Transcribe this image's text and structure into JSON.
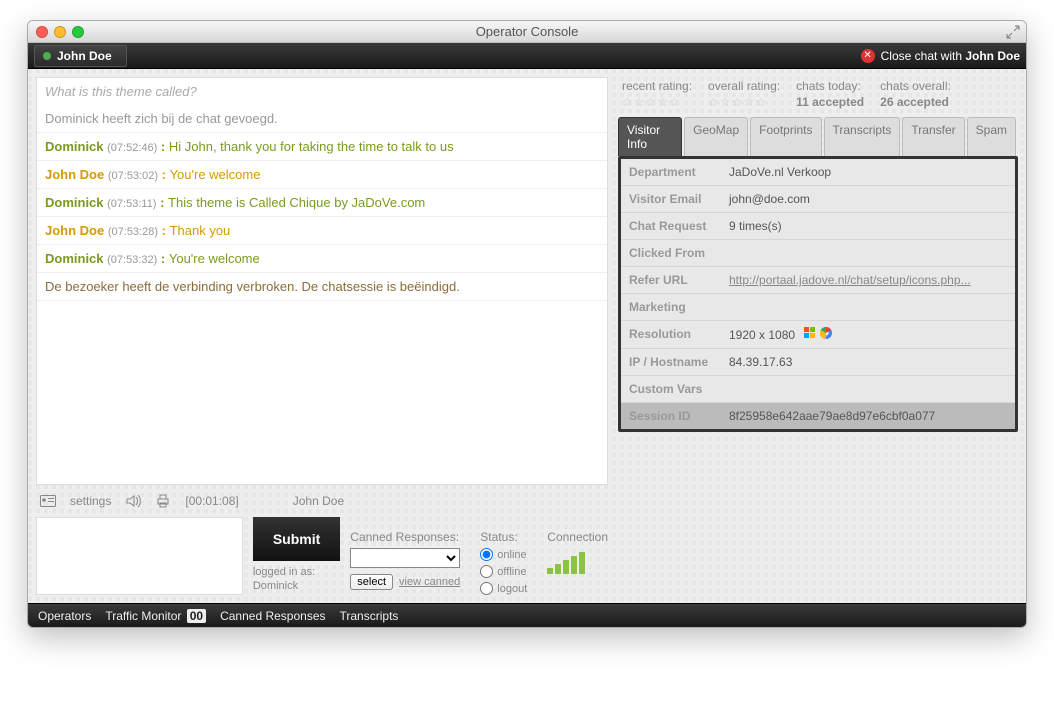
{
  "window": {
    "title": "Operator Console"
  },
  "topbar": {
    "visitor_name": "John Doe",
    "close_prefix": "Close chat with ",
    "close_name": "John Doe"
  },
  "chat": {
    "topic": "What is this theme called?",
    "system_joined": "Dominick heeft zich bij de chat gevoegd.",
    "lines": [
      {
        "role": "visitor",
        "who": "Dominick",
        "ts": "07:52:46",
        "msg": "Hi John, thank you for taking the time to talk to us"
      },
      {
        "role": "op",
        "who": "John Doe",
        "ts": "07:53:02",
        "msg": "You're welcome"
      },
      {
        "role": "visitor",
        "who": "Dominick",
        "ts": "07:53:11",
        "msg": "This theme is Called Chique by JaDoVe.com"
      },
      {
        "role": "op",
        "who": "John Doe",
        "ts": "07:53:28",
        "msg": "Thank you"
      },
      {
        "role": "visitor",
        "who": "Dominick",
        "ts": "07:53:32",
        "msg": "You're welcome"
      }
    ],
    "system_end": "De bezoeker heeft de verbinding verbroken. De chatsessie is beëindigd."
  },
  "toolbar": {
    "settings_label": "settings",
    "timer": "[00:01:08]",
    "whois": "John Doe"
  },
  "submit": {
    "button": "Submit",
    "logged_in_label": "logged in as:",
    "logged_in_name": "Dominick"
  },
  "stats": {
    "recent_label": "recent rating:",
    "overall_label": "overall rating:",
    "chats_today_label": "chats today:",
    "chats_today_value": "11 accepted",
    "chats_overall_label": "chats overall:",
    "chats_overall_value": "26 accepted"
  },
  "tabs": {
    "visitor_info": "Visitor Info",
    "geomap": "GeoMap",
    "footprints": "Footprints",
    "transcripts": "Transcripts",
    "transfer": "Transfer",
    "spam": "Spam"
  },
  "info": {
    "department_l": "Department",
    "department_v": "JaDoVe.nl Verkoop",
    "email_l": "Visitor Email",
    "email_v": "john@doe.com",
    "request_l": "Chat Request",
    "request_v": "9 times(s)",
    "clicked_l": "Clicked From",
    "clicked_v": "",
    "refer_l": "Refer URL",
    "refer_v": "http://portaal.jadove.nl/chat/setup/icons.php...",
    "marketing_l": "Marketing",
    "marketing_v": "",
    "resolution_l": "Resolution",
    "resolution_v": "1920 x 1080",
    "ip_l": "IP / Hostname",
    "ip_v": "84.39.17.63",
    "custom_l": "Custom Vars",
    "custom_v": "",
    "session_l": "Session ID",
    "session_v": "8f25958e642aae79ae8d97e6cbf0a077"
  },
  "widgets": {
    "canned_label": "Canned Responses:",
    "select_btn": "select",
    "view_canned": "view canned",
    "status_label": "Status:",
    "status_online": "online",
    "status_offline": "offline",
    "status_logout": "logout",
    "connection_label": "Connection"
  },
  "footer": {
    "operators": "Operators",
    "traffic": "Traffic Monitor",
    "traffic_count": "00",
    "canned": "Canned Responses",
    "transcripts": "Transcripts"
  }
}
